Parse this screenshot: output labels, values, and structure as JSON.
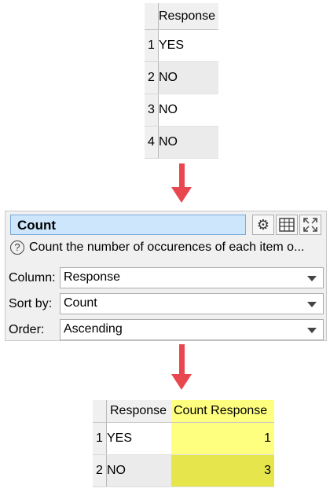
{
  "input_table": {
    "header": "Response",
    "rows": [
      {
        "num": "1",
        "value": "YES"
      },
      {
        "num": "2",
        "value": "NO"
      },
      {
        "num": "3",
        "value": "NO"
      },
      {
        "num": "4",
        "value": "NO"
      }
    ]
  },
  "panel": {
    "title": "Count",
    "description": "Count the number of occurences of each item o...",
    "help_icon": "?",
    "buttons": [
      "gear-icon",
      "table-icon",
      "maximize-icon"
    ],
    "fields": [
      {
        "label": "Column:",
        "value": "Response"
      },
      {
        "label": "Sort by:",
        "value": "Count"
      },
      {
        "label": "Order:",
        "value": "Ascending"
      }
    ]
  },
  "output_table": {
    "headers": [
      "Response",
      "Count Response"
    ],
    "rows": [
      {
        "num": "1",
        "response": "YES",
        "count": "1"
      },
      {
        "num": "2",
        "response": "NO",
        "count": "3"
      }
    ]
  },
  "colors": {
    "arrow": "#e8474f",
    "highlight": "#ffff7f",
    "highlight_alt": "#e6e64c",
    "title_bg": "#cde6fb"
  }
}
